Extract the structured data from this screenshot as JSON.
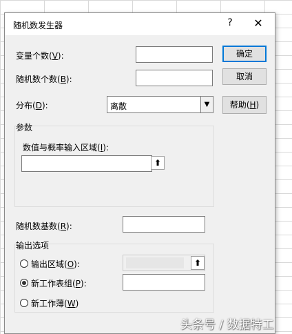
{
  "dialog": {
    "title": "随机数发生器",
    "help_glyph": "?",
    "close_glyph": "✕"
  },
  "fields": {
    "num_variables": {
      "label_pre": "变量个数(",
      "hotkey": "V",
      "label_post": "):",
      "value": ""
    },
    "num_random": {
      "label_pre": "随机数个数(",
      "hotkey": "B",
      "label_post": "):",
      "value": ""
    },
    "distribution": {
      "label_pre": "分布(",
      "hotkey": "D",
      "label_post": "):",
      "value": "离散"
    }
  },
  "buttons": {
    "ok": "确定",
    "cancel": "取消",
    "help": {
      "label_pre": "帮助(",
      "hotkey": "H",
      "label_post": ")"
    }
  },
  "params": {
    "group_label": "参数",
    "range_label": {
      "label_pre": "数值与概率输入区域(",
      "hotkey": "I",
      "label_post": "):"
    },
    "range_value": ""
  },
  "seed": {
    "label_pre": "随机数基数(",
    "hotkey": "R",
    "label_post": "):",
    "value": ""
  },
  "output": {
    "group_label": "输出选项",
    "options": [
      {
        "label_pre": "输出区域(",
        "hotkey": "O",
        "label_post": "):",
        "checked": false
      },
      {
        "label_pre": "新工作表组(",
        "hotkey": "P",
        "label_post": "):",
        "checked": true
      },
      {
        "label_pre": "新工作薄(",
        "hotkey": "W",
        "label_post": ")",
        "checked": false
      }
    ]
  },
  "icons": {
    "upload_glyph": "⬆"
  },
  "watermark": "头条号 / 数据特工"
}
